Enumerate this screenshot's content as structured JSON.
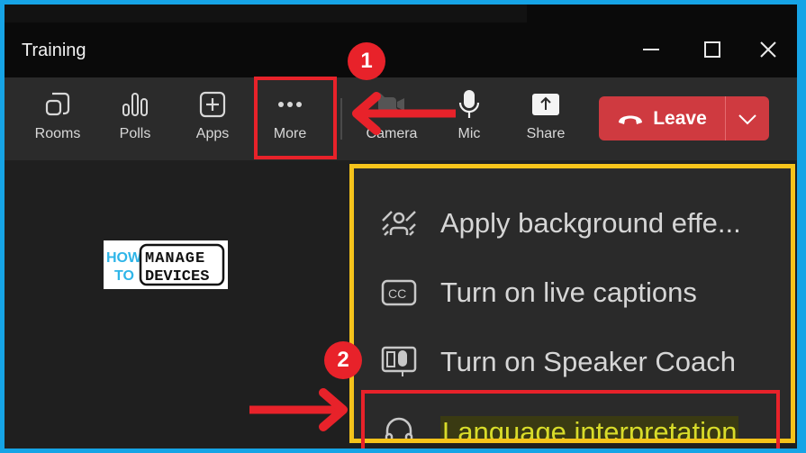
{
  "window": {
    "title": "Training",
    "controls": {
      "minimize": "minimize",
      "maximize": "maximize",
      "close": "close"
    }
  },
  "toolbar": {
    "buttons": [
      {
        "label": "Rooms",
        "icon": "rooms-icon"
      },
      {
        "label": "Polls",
        "icon": "polls-icon"
      },
      {
        "label": "Apps",
        "icon": "apps-icon"
      },
      {
        "label": "More",
        "icon": "more-icon"
      },
      {
        "label": "Camera",
        "icon": "camera-off-icon"
      },
      {
        "label": "Mic",
        "icon": "mic-icon"
      },
      {
        "label": "Share",
        "icon": "share-icon"
      }
    ],
    "leave": {
      "label": "Leave",
      "icon": "hang-up-icon",
      "color": "#cf3a40"
    }
  },
  "menu": {
    "items": [
      {
        "label": "Apply background effe...",
        "icon": "background-effects-icon"
      },
      {
        "label": "Turn on live captions",
        "icon": "closed-captions-icon"
      },
      {
        "label": "Turn on Speaker Coach",
        "icon": "speaker-coach-icon"
      },
      {
        "label": "Language interpretation",
        "icon": "headset-icon",
        "highlighted": true
      }
    ]
  },
  "logo": {
    "line1a": "HOW",
    "line1b": "MANAGE",
    "line2a": "TO",
    "line2b": "DEVICES"
  },
  "annotations": {
    "step1": "1",
    "step2": "2",
    "annotation_color": "#e8222a",
    "menu_outline_color": "#f5c31b"
  }
}
